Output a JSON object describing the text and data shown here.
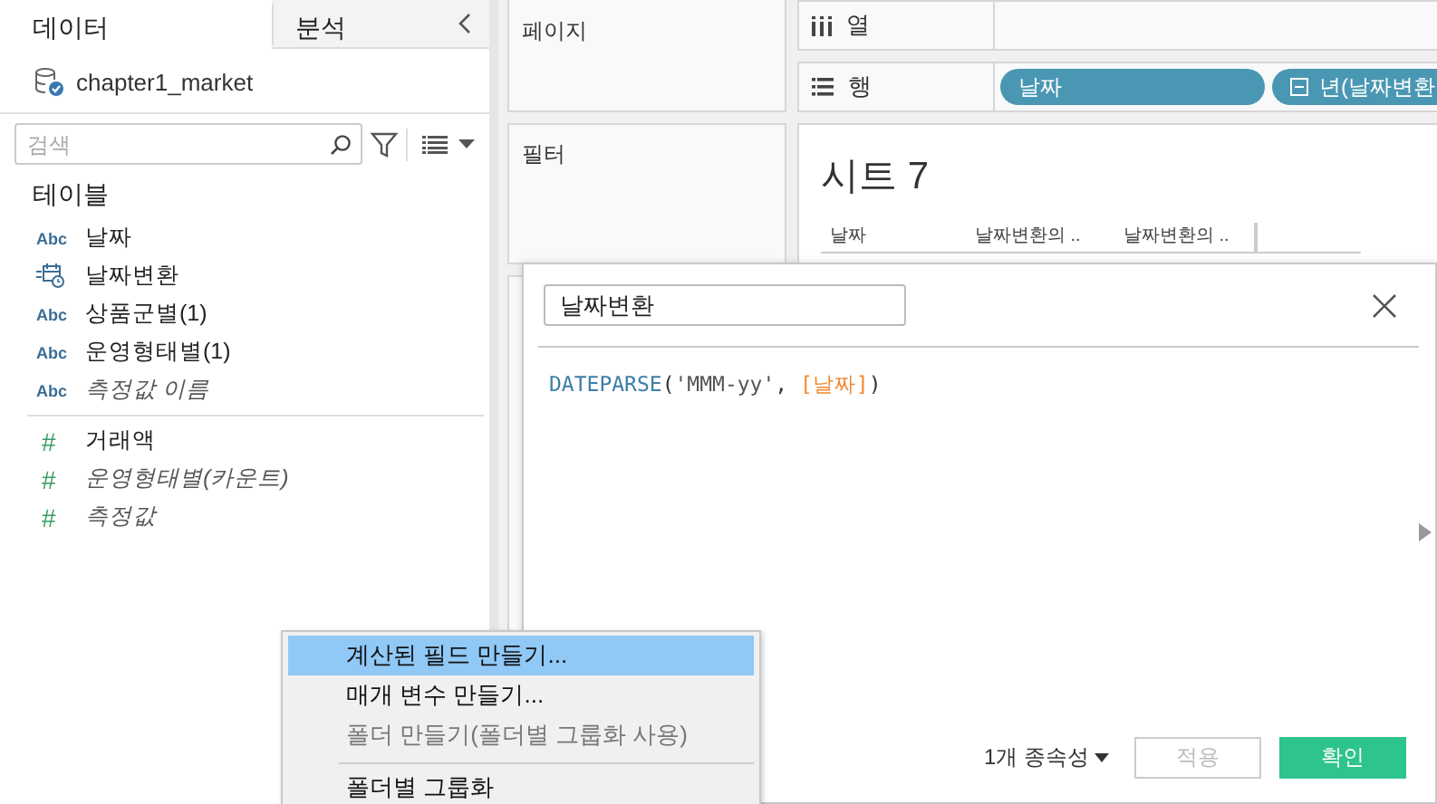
{
  "data_pane": {
    "tabs": [
      {
        "label": "데이터",
        "selected": true
      },
      {
        "label": "분석",
        "selected": false
      }
    ],
    "datasource": "chapter1_market",
    "search": {
      "placeholder": "검색"
    },
    "section_title": "테이블",
    "fields": [
      {
        "kind": "dimension",
        "type_label": "Abc",
        "name": "날짜",
        "italic": false
      },
      {
        "kind": "date",
        "name": "날짜변환",
        "italic": false
      },
      {
        "kind": "dimension",
        "type_label": "Abc",
        "name": "상품군별(1)",
        "italic": false
      },
      {
        "kind": "dimension",
        "type_label": "Abc",
        "name": "운영형태별(1)",
        "italic": false
      },
      {
        "kind": "dimension",
        "type_label": "Abc",
        "name": "측정값 이름",
        "italic": true
      },
      {
        "kind": "measure",
        "type_label": "#",
        "name": "거래액",
        "italic": false
      },
      {
        "kind": "measure",
        "type_label": "#",
        "name": "운영형태별(카운트)",
        "italic": true
      },
      {
        "kind": "measure",
        "type_label": "#",
        "name": "측정값",
        "italic": true
      }
    ]
  },
  "cards": [
    {
      "title": "페이지"
    },
    {
      "title": "필터"
    }
  ],
  "shelves": [
    {
      "kind": "columns",
      "label": "열"
    },
    {
      "kind": "rows",
      "label": "행",
      "pills": [
        {
          "label": "날짜",
          "collapse": false
        },
        {
          "label": "년(날짜변환",
          "collapse": true
        }
      ]
    }
  ],
  "sheet": {
    "title": "시트 7",
    "headers": [
      "날짜",
      "날짜변환의 ..",
      "날짜변환의 .."
    ]
  },
  "calc_dialog": {
    "name": "날짜변환",
    "formula": [
      {
        "kind": "function",
        "text": "DATEPARSE"
      },
      {
        "kind": "punct",
        "text": "("
      },
      {
        "kind": "string",
        "text": "'MMM-yy'"
      },
      {
        "kind": "punct",
        "text": ", "
      },
      {
        "kind": "field",
        "text": "[날짜]"
      },
      {
        "kind": "punct",
        "text": ")"
      }
    ],
    "dependencies": "1개 종속성",
    "buttons": [
      {
        "kind": "secondary",
        "label": "적용",
        "disabled": true
      },
      {
        "kind": "primary",
        "label": "확인",
        "disabled": false
      }
    ]
  },
  "context_menu": [
    {
      "label": "계산된 필드 만들기...",
      "selected": true,
      "disabled": false,
      "separator_before": false
    },
    {
      "label": "매개 변수 만들기...",
      "selected": false,
      "disabled": false,
      "separator_before": false
    },
    {
      "label": "폴더 만들기(폴더별 그룹화 사용)",
      "selected": false,
      "disabled": true,
      "separator_before": false
    },
    {
      "label": "폴더별 그룹화",
      "selected": false,
      "disabled": false,
      "separator_before": true
    }
  ]
}
